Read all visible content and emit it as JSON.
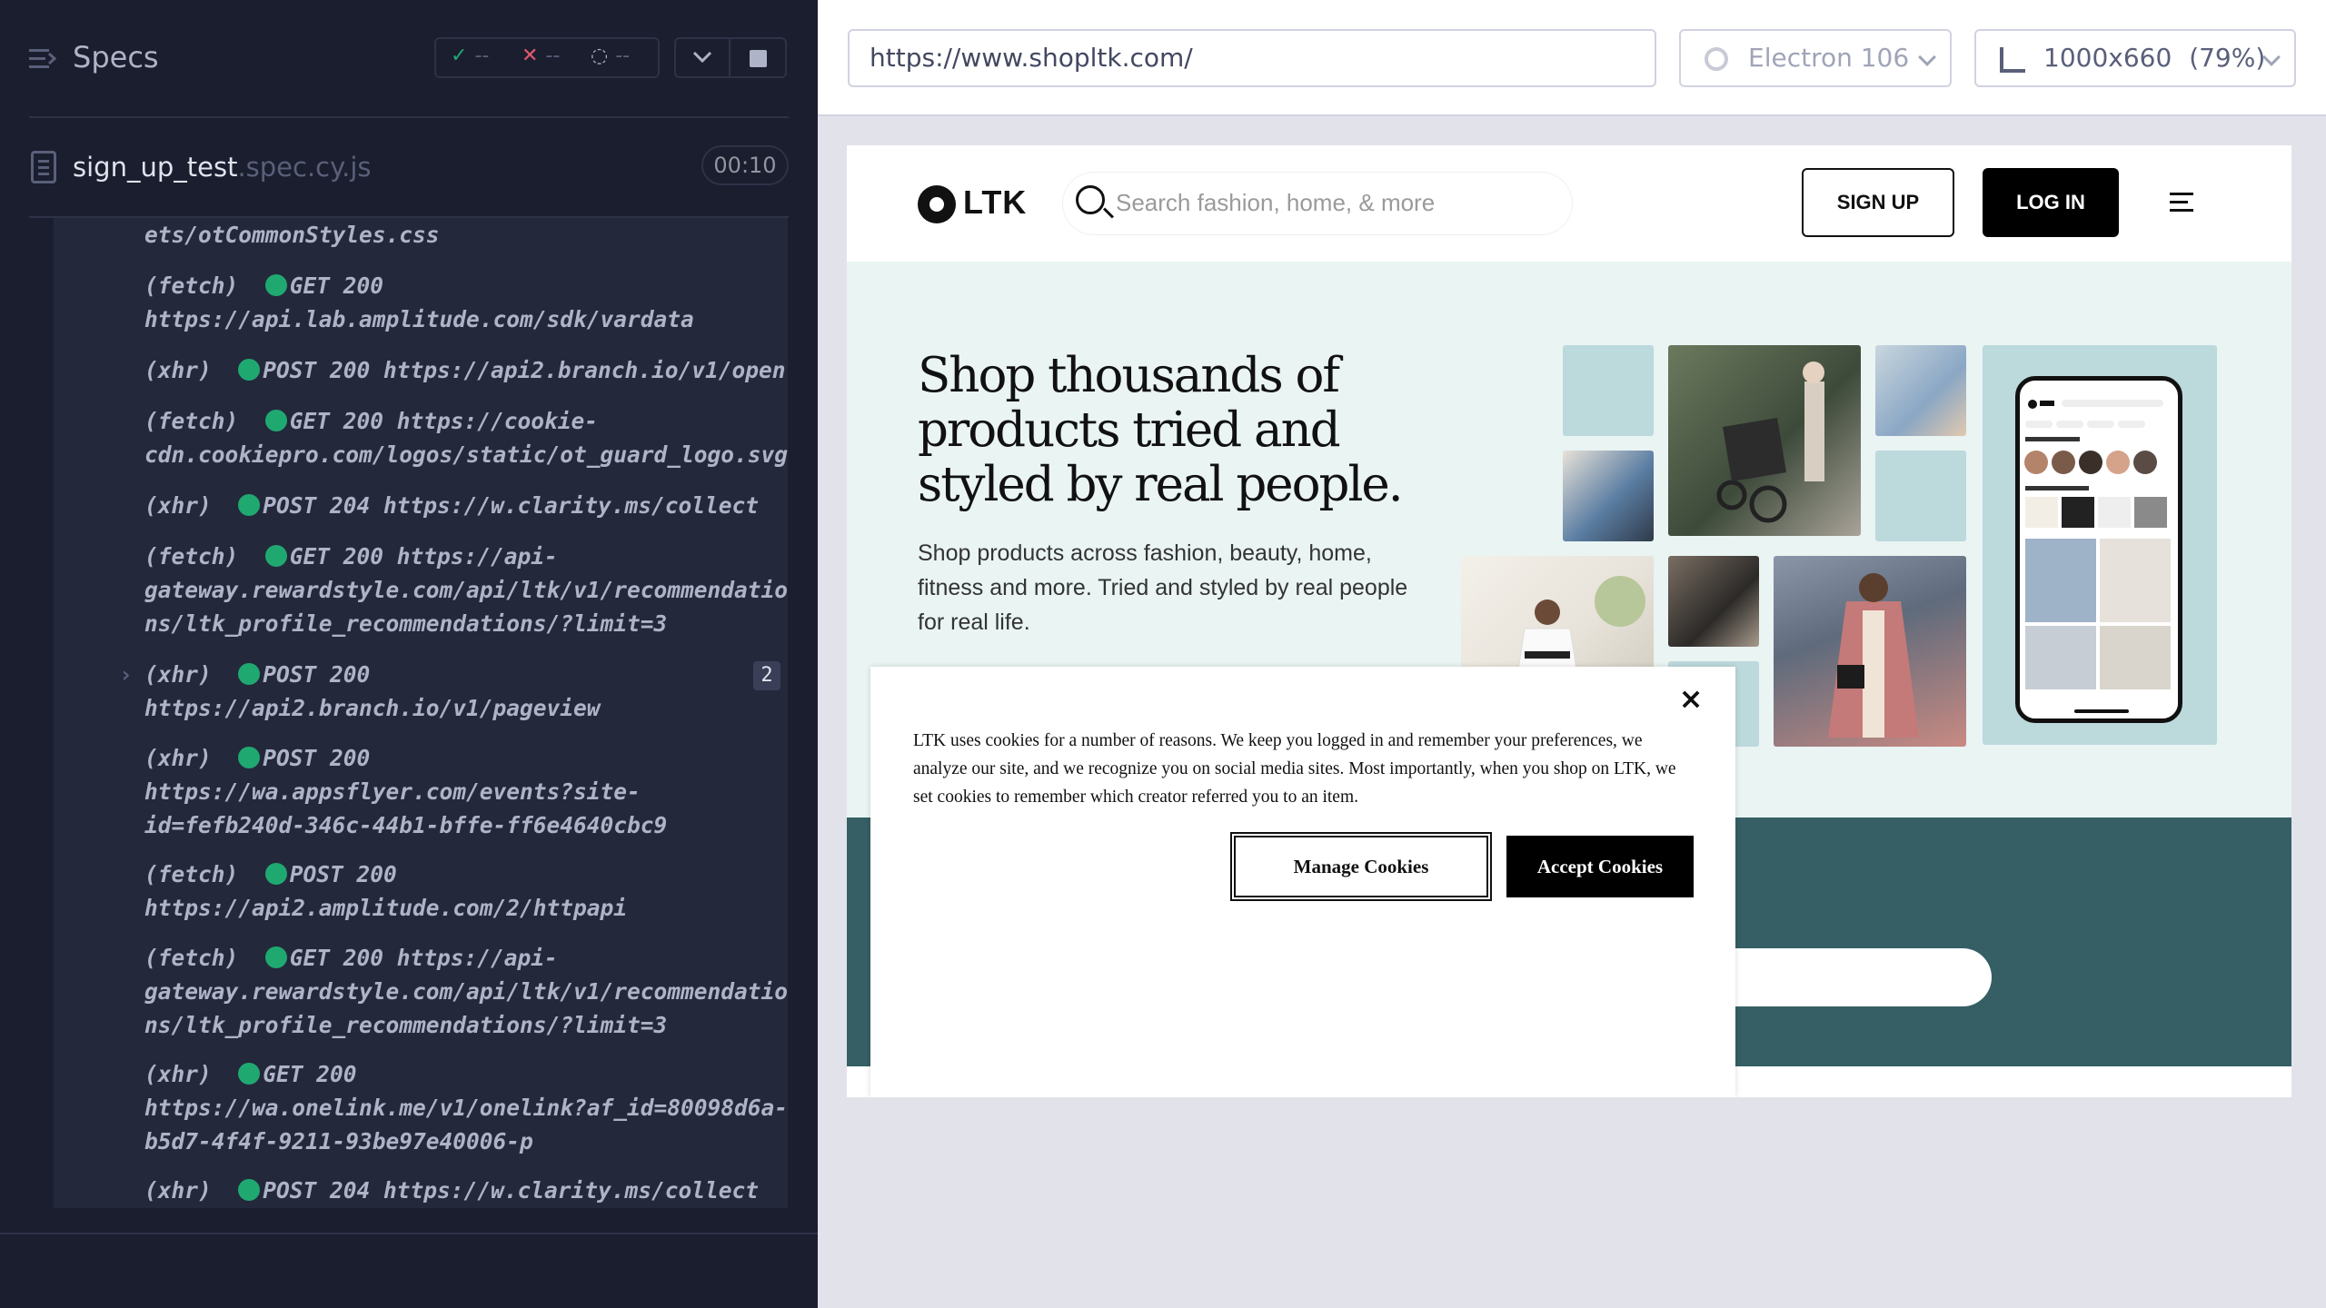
{
  "runner": {
    "title": "Specs",
    "stats": {
      "passed": "--",
      "failed": "--",
      "pending": "--"
    },
    "spec_file": {
      "name": "sign_up_test",
      "ext": ".spec.cy.js",
      "timer": "00:10"
    },
    "log": [
      {
        "text": "ets/otCommonStyles.css"
      },
      {
        "type": "(fetch)",
        "method": "GET 200",
        "url": "https://api.lab.amplitude.com/sdk/vardata"
      },
      {
        "type": "(xhr)",
        "method": "POST 200",
        "url": "https://api2.branch.io/v1/open"
      },
      {
        "type": "(fetch)",
        "method": "GET 200",
        "url": "https://cookie-cdn.cookiepro.com/logos/static/ot_guard_logo.svg"
      },
      {
        "type": "(xhr)",
        "method": "POST 204",
        "url": "https://w.clarity.ms/collect"
      },
      {
        "type": "(fetch)",
        "method": "GET 200",
        "url": "https://api-gateway.rewardstyle.com/api/ltk/v1/recommendations/ltk_profile_recommendations/?limit=3"
      },
      {
        "type": "(xhr)",
        "method": "POST 200",
        "url": "https://api2.branch.io/v1/pageview",
        "count": "2"
      },
      {
        "type": "(xhr)",
        "method": "POST 200",
        "url": "https://wa.appsflyer.com/events?site-id=fefb240d-346c-44b1-bffe-ff6e4640cbc9"
      },
      {
        "type": "(fetch)",
        "method": "POST 200",
        "url": "https://api2.amplitude.com/2/httpapi"
      },
      {
        "type": "(fetch)",
        "method": "GET 200",
        "url": "https://api-gateway.rewardstyle.com/api/ltk/v1/recommendations/ltk_profile_recommendations/?limit=3"
      },
      {
        "type": "(xhr)",
        "method": "GET 200",
        "url": "https://wa.onelink.me/v1/onelink?af_id=80098d6a-b5d7-4f4f-9211-93be97e40006-p"
      },
      {
        "type": "(xhr)",
        "method": "POST 204",
        "url": "https://w.clarity.ms/collect"
      }
    ]
  },
  "browser": {
    "url": "https://www.shopltk.com/",
    "engine": "Electron 106",
    "viewport": "1000x660",
    "zoom": "(79%)"
  },
  "site": {
    "logo": "LTK",
    "search_placeholder": "Search fashion, home, & more",
    "signup": "SIGN UP",
    "login": "LOG IN",
    "hero_title": "Shop thousands of products tried and styled by real people.",
    "hero_sub": "Shop products across fashion, beauty, home, fitness and more. Tried and styled by real people for real life."
  },
  "cookie": {
    "text": "LTK uses cookies for a number of reasons. We keep you logged in and remember your preferences, we analyze our site, and we recognize you on social media sites. Most importantly, when you shop on LTK, we set cookies to remember which creator referred you to an item.",
    "manage": "Manage Cookies",
    "accept": "Accept Cookies",
    "close": "×"
  },
  "colors": {
    "runner_bg": "#1b1e2e",
    "log_bg": "#24283b",
    "success": "#1fa971",
    "fail": "#e45770",
    "hero_bg": "#e9f4f3",
    "band": "#355f65",
    "tile": "#bcd9dc"
  },
  "icons": [
    "menu-icon",
    "check-icon",
    "x-icon",
    "spinner-icon",
    "chevron-down-icon",
    "stop-icon",
    "file-icon",
    "gear-icon",
    "ruler-icon",
    "search-icon",
    "hamburger-icon",
    "close-icon"
  ]
}
